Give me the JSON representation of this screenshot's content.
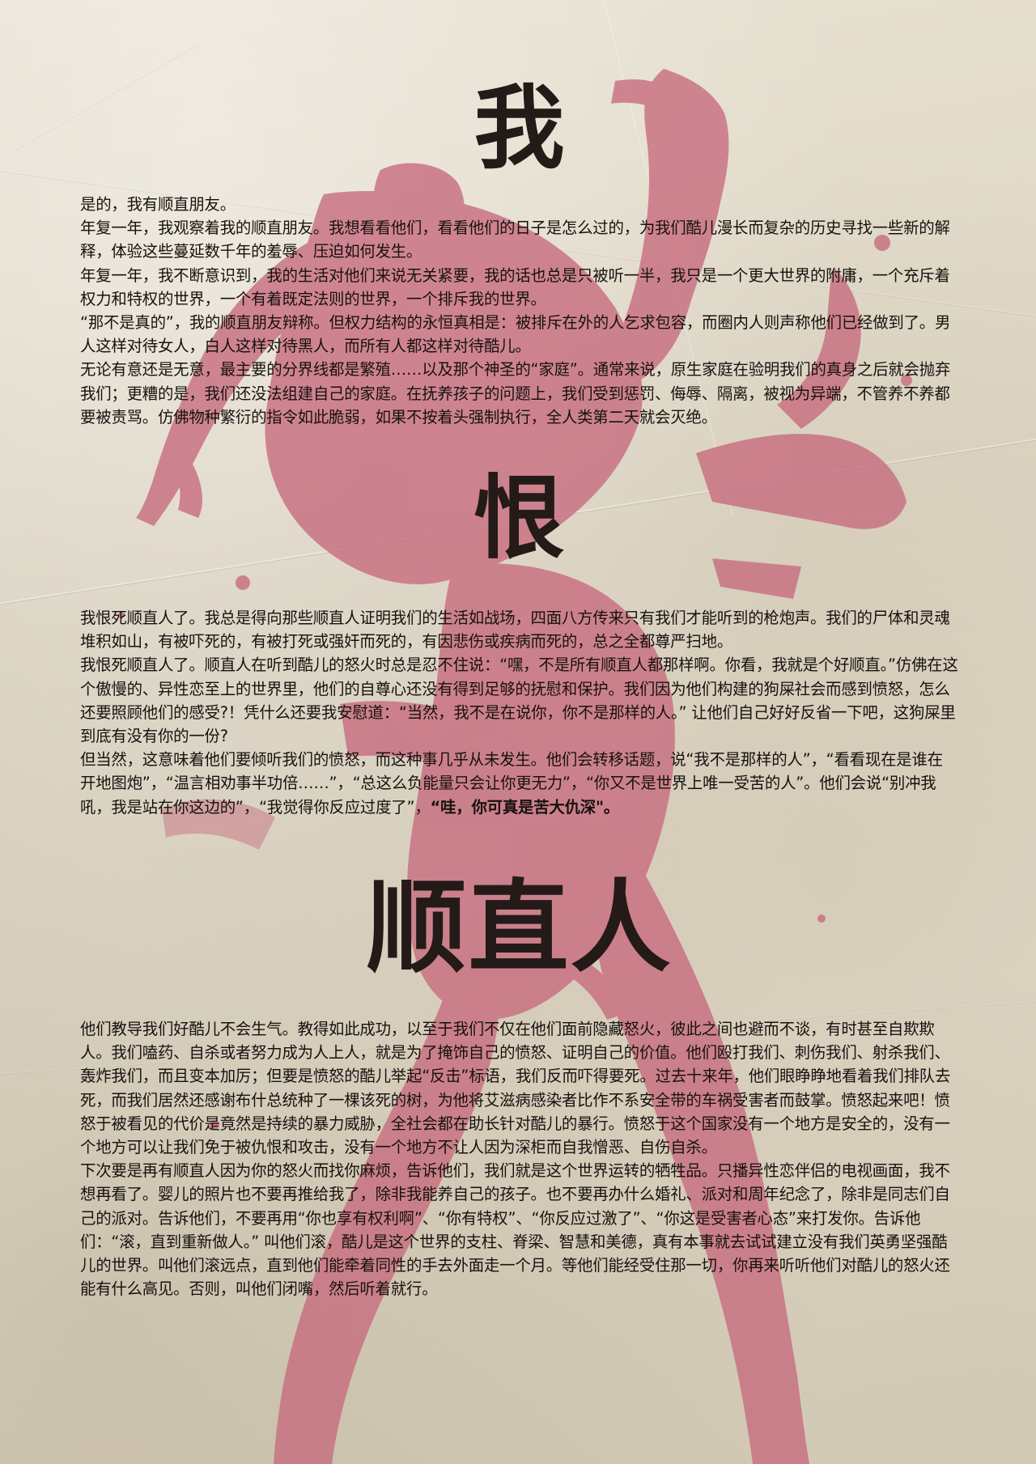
{
  "headings": {
    "first": "我",
    "second": "恨",
    "third": "顺直人"
  },
  "section_one": {
    "paragraphs": [
      "是的，我有顺直朋友。",
      "年复一年，我观察着我的顺直朋友。我想看看他们，看看他们的日子是怎么过的，为我们酷儿漫长而复杂的历史寻找一些新的解释，体验这些蔓延数千年的羞辱、压迫如何发生。",
      "年复一年，我不断意识到，我的生活对他们来说无关紧要，我的话也总是只被听一半，我只是一个更大世界的附庸，一个充斥着权力和特权的世界，一个有着既定法则的世界，一个排斥我的世界。",
      "“那不是真的”，我的顺直朋友辩称。但权力结构的永恒真相是：被排斥在外的人乞求包容，而圈内人则声称他们已经做到了。男人这样对待女人，白人这样对待黑人，而所有人都这样对待酷儿。",
      "无论有意还是无意，最主要的分界线都是繁殖……以及那个神圣的“家庭”。通常来说，原生家庭在验明我们的真身之后就会抛弃我们；更糟的是，我们还没法组建自己的家庭。在抚养孩子的问题上，我们受到惩罚、侮辱、隔离，被视为异端，不管养不养都要被责骂。仿佛物种繁衍的指令如此脆弱，如果不按着头强制执行，全人类第二天就会灭绝。"
    ]
  },
  "section_two": {
    "paragraphs": [
      "我恨死顺直人了。我总是得向那些顺直人证明我们的生活如战场，四面八方传来只有我们才能听到的枪炮声。我们的尸体和灵魂堆积如山，有被吓死的，有被打死或强奸而死的，有因悲伤或疾病而死的，总之全都尊严扫地。",
      "我恨死顺直人了。顺直人在听到酷儿的怒火时总是忍不住说：“嘿，不是所有顺直人都那样啊。你看，我就是个好顺直。”仿佛在这个傲慢的、异性恋至上的世界里，他们的自尊心还没有得到足够的抚慰和保护。我们因为他们构建的狗屎社会而感到愤怒，怎么还要照顾他们的感受?！凭什么还要我安慰道：“当然，我不是在说你，你不是那样的人。” 让他们自己好好反省一下吧，这狗屎里到底有没有你的一份?"
    ],
    "last_paragraph_plain": "但当然，这意味着他们要倾听我们的愤怒，而这种事几乎从未发生。他们会转移话题，说“我不是那样的人”，“看看现在是谁在开地图炮”，“温言相劝事半功倍……”，“总这么负能量只会让你更无力”，“你又不是世界上唯一受苦的人”。他们会说“别冲我吼，我是站在你这边的”，“我觉得你反应过度了”，",
    "last_paragraph_bold": "“哇，你可真是苦大仇深\"。"
  },
  "section_three": {
    "paragraphs": [
      "他们教导我们好酷儿不会生气。教得如此成功，以至于我们不仅在他们面前隐藏怒火，彼此之间也避而不谈，有时甚至自欺欺人。我们嗑药、自杀或者努力成为人上人，就是为了掩饰自己的愤怒、证明自己的价值。他们殴打我们、刺伤我们、射杀我们、轰炸我们，而且变本加厉；但要是愤怒的酷儿举起“反击”标语，我们反而吓得要死。过去十来年，他们眼睁睁地看着我们排队去死，而我们居然还感谢布什总统种了一棵该死的树，为他将艾滋病感染者比作不系安全带的车祸受害者而鼓掌。愤怒起来吧！愤怒于被看见的代价是竟然是持续的暴力威胁，全社会都在助长针对酷儿的暴行。愤怒于这个国家没有一个地方是安全的，没有一个地方可以让我们免于被仇恨和攻击，没有一个地方不让人因为深柜而自我憎恶、自伤自杀。",
      "下次要是再有顺直人因为你的怒火而找你麻烦，告诉他们，我们就是这个世界运转的牺牲品。只播异性恋伴侣的电视画面，我不想再看了。婴儿的照片也不要再推给我了，除非我能养自己的孩子。也不要再办什么婚礼、派对和周年纪念了，除非是同志们自己的派对。告诉他们，不要再用“你也享有权利啊”、“你有特权”、“你反应过激了”、“你这是受害者心态”来打发你。告诉他们：“滚，直到重新做人。” 叫他们滚，酷儿是这个世界的支柱、脊梁、智慧和美德，真有本事就去试试建立没有我们英勇坚强酷儿的世界。叫他们滚远点，直到他们能牵着同性的手去外面走一个月。等他们能经受住那一切，你再来听听他们对酷儿的怒火还能有什么高见。否则，叫他们闭嘴，然后听着就行。"
    ]
  },
  "colors": {
    "background": "#e3dccb",
    "figure": "#c76a7d",
    "text": "#17110f",
    "heading": "#241a17"
  }
}
